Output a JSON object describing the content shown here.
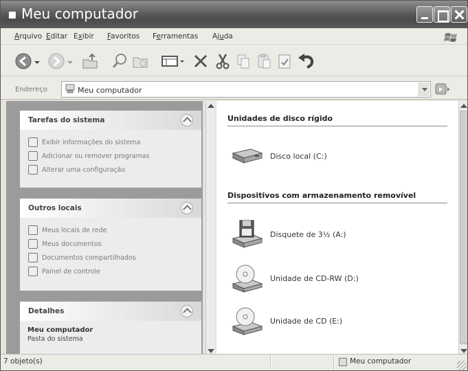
{
  "window": {
    "title": "Meu computador"
  },
  "menu": [
    {
      "label": "Arquivo",
      "underline": "A"
    },
    {
      "label": "Editar",
      "underline": "E"
    },
    {
      "label": "Exibir",
      "underline": "x"
    },
    {
      "label": "Favoritos",
      "underline": "F"
    },
    {
      "label": "Ferramentas",
      "underline": "e"
    },
    {
      "label": "Ajuda",
      "underline": "u"
    }
  ],
  "toolbar": {
    "icons": [
      "back-icon",
      "forward-icon",
      "up-folder-icon",
      "search-icon",
      "folders-icon",
      "views-icon",
      "delete-icon",
      "cut-icon",
      "copy-icon",
      "paste-icon",
      "properties-icon",
      "undo-icon"
    ]
  },
  "address": {
    "label": "Endereço",
    "value": "Meu computador"
  },
  "left_pane": {
    "system_tasks": {
      "title": "Tarefas do sistema",
      "items": [
        {
          "label": "Exibir informações do sistema",
          "icon": "system-info-icon"
        },
        {
          "label": "Adicionar ou remover programas",
          "icon": "add-remove-icon"
        },
        {
          "label": "Alterar uma configuração",
          "icon": "control-panel-icon"
        }
      ]
    },
    "other_places": {
      "title": "Outros locais",
      "items": [
        {
          "label": "Meus locais de rede",
          "icon": "network-places-icon"
        },
        {
          "label": "Meus documentos",
          "icon": "my-documents-icon"
        },
        {
          "label": "Documentos compartilhados",
          "icon": "shared-documents-icon"
        },
        {
          "label": "Painel de controle",
          "icon": "control-panel-icon"
        }
      ]
    },
    "details": {
      "title": "Detalhes",
      "name": "Meu computador",
      "type": "Pasta do sistema"
    }
  },
  "content": {
    "groups": [
      {
        "title": "Unidades de disco rígido",
        "items": [
          {
            "label": "Disco local (C:)",
            "icon": "hard-disk-icon"
          }
        ]
      },
      {
        "title": "Dispositivos com armazenamento removível",
        "items": [
          {
            "label": "Disquete de 3½ (A:)",
            "icon": "floppy-drive-icon"
          },
          {
            "label": "Unidade de CD-RW (D:)",
            "icon": "cd-rw-drive-icon"
          },
          {
            "label": "Unidade de CD (E:)",
            "icon": "cd-drive-icon"
          }
        ]
      }
    ]
  },
  "status": {
    "objects": "7 objeto(s)",
    "location": "Meu computador"
  },
  "colors": {
    "titlebar": "#5c5c5c",
    "task_pane": "#9b9b9b",
    "panel_head": "#ffffff"
  }
}
